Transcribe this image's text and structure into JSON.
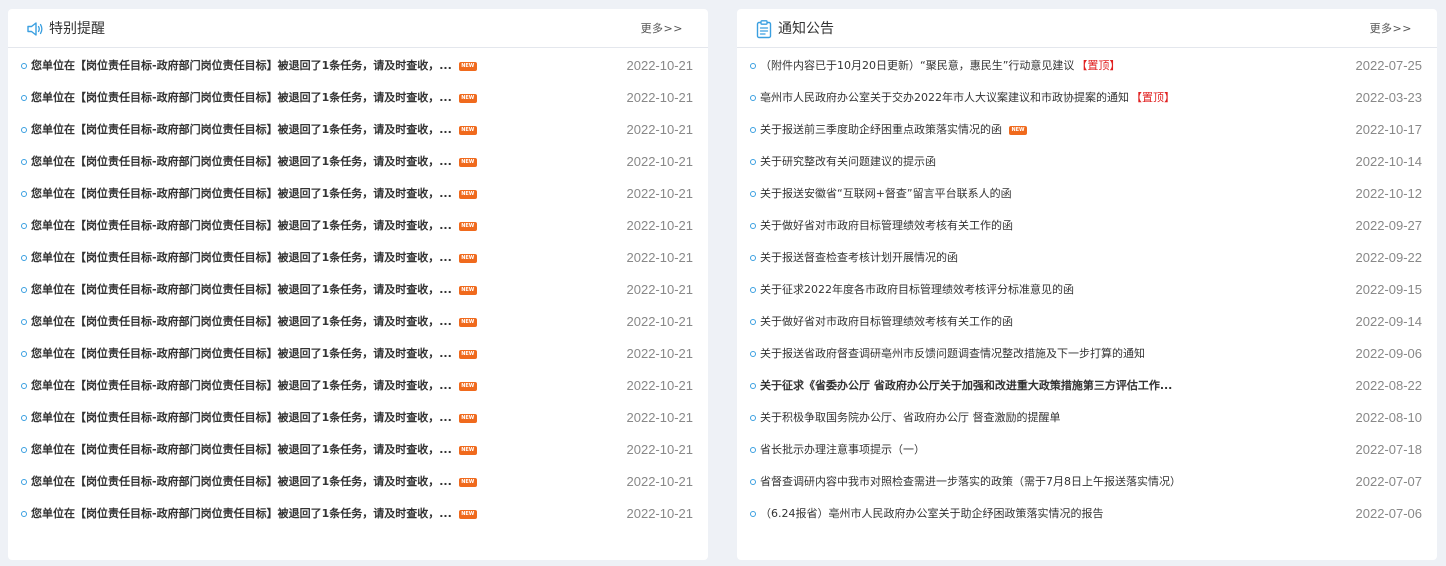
{
  "left_panel": {
    "title": "特别提醒",
    "icon": "speaker-icon",
    "more": "更多>>",
    "items": [
      {
        "text": "您单位在【岗位责任目标-政府部门岗位责任目标】被退回了1条任务，请及时查收，...",
        "date": "2022-10-21",
        "new": "NEW"
      },
      {
        "text": "您单位在【岗位责任目标-政府部门岗位责任目标】被退回了1条任务，请及时查收，...",
        "date": "2022-10-21",
        "new": "NEW"
      },
      {
        "text": "您单位在【岗位责任目标-政府部门岗位责任目标】被退回了1条任务，请及时查收，...",
        "date": "2022-10-21",
        "new": "NEW"
      },
      {
        "text": "您单位在【岗位责任目标-政府部门岗位责任目标】被退回了1条任务，请及时查收，...",
        "date": "2022-10-21",
        "new": "NEW"
      },
      {
        "text": "您单位在【岗位责任目标-政府部门岗位责任目标】被退回了1条任务，请及时查收，...",
        "date": "2022-10-21",
        "new": "NEW"
      },
      {
        "text": "您单位在【岗位责任目标-政府部门岗位责任目标】被退回了1条任务，请及时查收，...",
        "date": "2022-10-21",
        "new": "NEW"
      },
      {
        "text": "您单位在【岗位责任目标-政府部门岗位责任目标】被退回了1条任务，请及时查收，...",
        "date": "2022-10-21",
        "new": "NEW"
      },
      {
        "text": "您单位在【岗位责任目标-政府部门岗位责任目标】被退回了1条任务，请及时查收，...",
        "date": "2022-10-21",
        "new": "NEW"
      },
      {
        "text": "您单位在【岗位责任目标-政府部门岗位责任目标】被退回了1条任务，请及时查收，...",
        "date": "2022-10-21",
        "new": "NEW"
      },
      {
        "text": "您单位在【岗位责任目标-政府部门岗位责任目标】被退回了1条任务，请及时查收，...",
        "date": "2022-10-21",
        "new": "NEW"
      },
      {
        "text": "您单位在【岗位责任目标-政府部门岗位责任目标】被退回了1条任务，请及时查收，...",
        "date": "2022-10-21",
        "new": "NEW"
      },
      {
        "text": "您单位在【岗位责任目标-政府部门岗位责任目标】被退回了1条任务，请及时查收，...",
        "date": "2022-10-21",
        "new": "NEW"
      },
      {
        "text": "您单位在【岗位责任目标-政府部门岗位责任目标】被退回了1条任务，请及时查收，...",
        "date": "2022-10-21",
        "new": "NEW"
      },
      {
        "text": "您单位在【岗位责任目标-政府部门岗位责任目标】被退回了1条任务，请及时查收，...",
        "date": "2022-10-21",
        "new": "NEW"
      },
      {
        "text": "您单位在【岗位责任目标-政府部门岗位责任目标】被退回了1条任务，请及时查收，...",
        "date": "2022-10-21",
        "new": "NEW"
      }
    ]
  },
  "right_panel": {
    "title": "通知公告",
    "icon": "clipboard-icon",
    "more": "更多>>",
    "items": [
      {
        "text": "（附件内容已于10月20日更新）“聚民意，惠民生”行动意见建议",
        "pin": "【置顶】",
        "date": "2022-07-25"
      },
      {
        "text": "亳州市人民政府办公室关于交办2022年市人大议案建议和市政协提案的通知",
        "pin": "【置顶】",
        "date": "2022-03-23"
      },
      {
        "text": "关于报送前三季度助企纾困重点政策落实情况的函",
        "new": "NEW",
        "date": "2022-10-17"
      },
      {
        "text": "关于研究整改有关问题建议的提示函",
        "date": "2022-10-14"
      },
      {
        "text": "关于报送安徽省“互联网+督查”留言平台联系人的函",
        "date": "2022-10-12"
      },
      {
        "text": "关于做好省对市政府目标管理绩效考核有关工作的函",
        "date": "2022-09-27"
      },
      {
        "text": "关于报送督查检查考核计划开展情况的函",
        "date": "2022-09-22"
      },
      {
        "text": "关于征求2022年度各市政府目标管理绩效考核评分标准意见的函",
        "date": "2022-09-15"
      },
      {
        "text": "关于做好省对市政府目标管理绩效考核有关工作的函",
        "date": "2022-09-14"
      },
      {
        "text": "关于报送省政府督查调研亳州市反馈问题调查情况整改措施及下一步打算的通知",
        "date": "2022-09-06"
      },
      {
        "text": "关于征求《省委办公厅 省政府办公厅关于加强和改进重大政策措施第三方评估工作...",
        "bold": true,
        "date": "2022-08-22"
      },
      {
        "text": "关于积极争取国务院办公厅、省政府办公厅 督查激励的提醒单",
        "date": "2022-08-10"
      },
      {
        "text": "省长批示办理注意事项提示（一）",
        "date": "2022-07-18"
      },
      {
        "text": "省督查调研内容中我市对照检查需进一步落实的政策（需于7月8日上午报送落实情况）",
        "date": "2022-07-07"
      },
      {
        "text": "（6.24报省）亳州市人民政府办公室关于助企纾困政策落实情况的报告",
        "date": "2022-07-06"
      }
    ]
  }
}
